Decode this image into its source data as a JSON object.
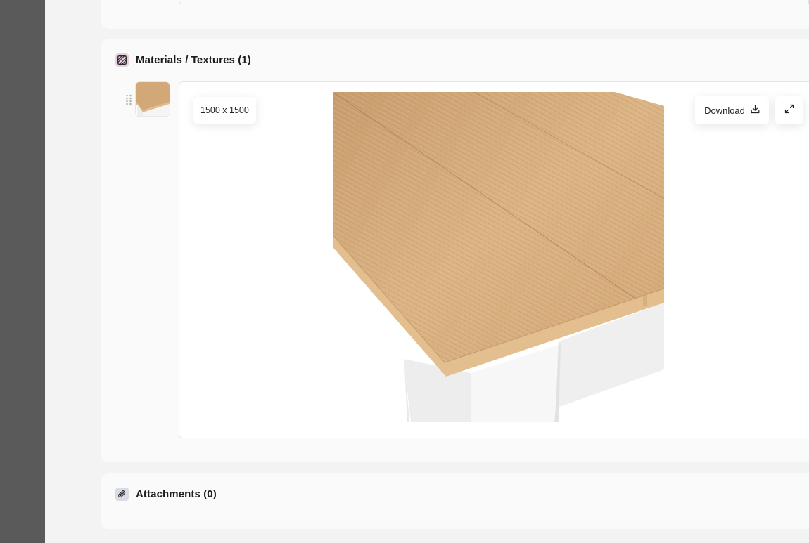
{
  "materials": {
    "title": "Materials / Textures (1)",
    "icon": "texture-icon",
    "image_size": "1500 x 1500",
    "download_label": "Download",
    "expand_icon": "expand-icon"
  },
  "attachments": {
    "title": "Attachments (0)",
    "icon": "paperclip-icon"
  },
  "colors": {
    "materials_icon_bg": "#e7cfe2",
    "attachments_icon_bg": "#d9dbe6",
    "wood": "#d2a878"
  }
}
